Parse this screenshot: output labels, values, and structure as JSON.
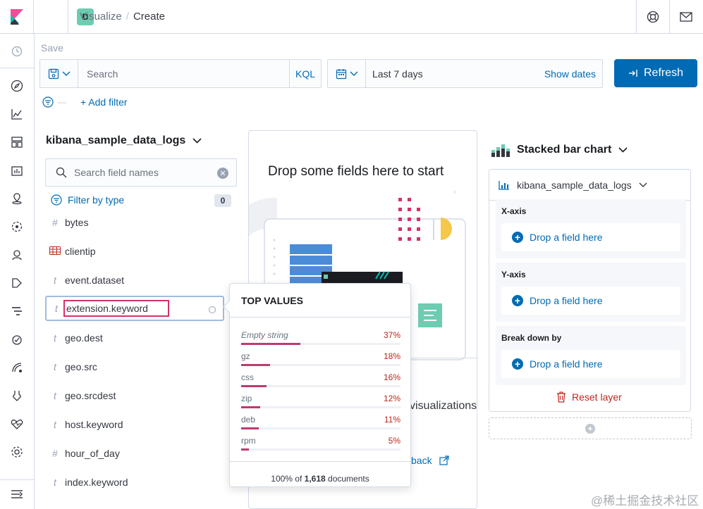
{
  "header": {
    "space_initial": "D",
    "breadcrumb_parent": "Visualize",
    "breadcrumb_separator": "/",
    "breadcrumb_current": "Create"
  },
  "toolbar": {
    "save_label": "Save",
    "search_placeholder": "Search",
    "query_language": "KQL",
    "date_range": "Last 7 days",
    "show_dates_label": "Show dates",
    "refresh_label": "Refresh",
    "filter_separator": "—",
    "add_filter_label": "+ Add filter"
  },
  "sidebar": {
    "index_pattern": "kibana_sample_data_logs",
    "search_placeholder": "Search field names",
    "filter_by_type_label": "Filter by type",
    "filter_count": "0",
    "fields": [
      {
        "type": "#",
        "name": "bytes"
      },
      {
        "type": "ip",
        "name": "clientip"
      },
      {
        "type": "t",
        "name": "event.dataset"
      },
      {
        "type": "t",
        "name": "extension.keyword"
      },
      {
        "type": "t",
        "name": "geo.dest"
      },
      {
        "type": "t",
        "name": "geo.src"
      },
      {
        "type": "t",
        "name": "geo.srcdest"
      },
      {
        "type": "t",
        "name": "host.keyword"
      },
      {
        "type": "#",
        "name": "hour_of_day"
      },
      {
        "type": "t",
        "name": "index.keyword"
      }
    ]
  },
  "workspace": {
    "title": "Drop some fields here to start",
    "suggestions_fragment": "visualizations",
    "feedback_fragment": "back"
  },
  "top_values": {
    "title": "TOP VALUES",
    "rows": [
      {
        "label": "Empty string",
        "percent": "37%",
        "value": 37
      },
      {
        "label": "gz",
        "percent": "18%",
        "value": 18
      },
      {
        "label": "css",
        "percent": "16%",
        "value": 16
      },
      {
        "label": "zip",
        "percent": "12%",
        "value": 12
      },
      {
        "label": "deb",
        "percent": "11%",
        "value": 11
      },
      {
        "label": "rpm",
        "percent": "5%",
        "value": 5
      }
    ],
    "footer_prefix": "100% of",
    "footer_count": "1,618",
    "footer_suffix": "documents"
  },
  "config": {
    "chart_type": "Stacked bar chart",
    "layer_index": "kibana_sample_data_logs",
    "groups": [
      {
        "label": "X-axis",
        "drop_label": "Drop a field here"
      },
      {
        "label": "Y-axis",
        "drop_label": "Drop a field here"
      },
      {
        "label": "Break down by",
        "drop_label": "Drop a field here"
      }
    ],
    "reset_layer_label": "Reset layer"
  },
  "watermark": "@稀土掘金技术社区",
  "colors": {
    "primary": "#006bb4",
    "danger": "#bd271e",
    "bar": "#bf3a6f",
    "highlight": "#d6306b"
  }
}
